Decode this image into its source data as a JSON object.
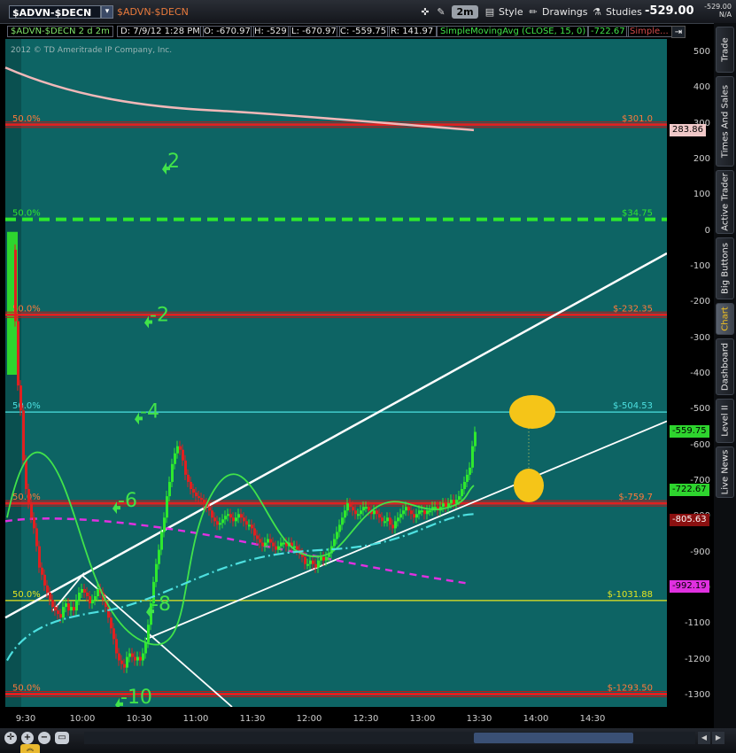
{
  "toolbar": {
    "symbol": "$ADVN-$DECN",
    "symbol_label": "$ADVN-$DECN",
    "aggregation": "2m",
    "style_label": "Style",
    "drawings_label": "Drawings",
    "studies_label": "Studies",
    "last_price": "-529.00",
    "mini_quote_price": "-529.00",
    "mini_quote_change": "N/A"
  },
  "infobar": {
    "symbol_period": "$ADVN-$DECN 2 d 2m",
    "date": "D: 7/9/12 1:28 PM",
    "open": "O: -670.97",
    "high": "H: -529",
    "low": "L: -670.97",
    "close": "C: -559.75",
    "range": "R: 141.97",
    "study": "SimpleMovingAvg (CLOSE, 15, 0)",
    "study_value": "-722.67",
    "study2": "Simple..."
  },
  "copyright": "2012 © TD Ameritrade IP Company, Inc.",
  "chart_data": {
    "type": "candlestick",
    "y_axis": {
      "min": -1330,
      "max": 540,
      "ticks": [
        500,
        400,
        300,
        200,
        100,
        0,
        -100,
        -200,
        -300,
        -400,
        -500,
        -600,
        -700,
        -800,
        -900,
        -1000,
        -1100,
        -1200,
        -1300
      ]
    },
    "x_axis": {
      "ticks": [
        "9:30",
        "10:00",
        "10:30",
        "11:00",
        "11:30",
        "12:00",
        "12:30",
        "13:00",
        "13:30",
        "14:00",
        "14:30"
      ]
    },
    "background_color": "#0d6464",
    "level_lines": [
      {
        "value": 300,
        "color": "#e02020",
        "left_label": "50.0%",
        "right_label": "$301.0",
        "badge": ""
      },
      {
        "value": 35,
        "color": "#2ee82e",
        "left_label": "50.0%",
        "right_label": "$34.75",
        "dashed": true,
        "badge": ""
      },
      {
        "value": -232,
        "color": "#e02020",
        "left_label": "50.0%",
        "right_label": "$-232.35",
        "badge": ""
      },
      {
        "value": -504.5,
        "color": "#4de0e0",
        "left_label": "50.0%",
        "right_label": "$-504.53",
        "badge": ""
      },
      {
        "value": -760,
        "color": "#e02020",
        "left_label": "50.0%",
        "right_label": "$-759.7",
        "badge": ""
      },
      {
        "value": -1032,
        "color": "#e6e620",
        "left_label": "50.0%",
        "right_label": "$-1031.88",
        "badge": ""
      },
      {
        "value": -1294,
        "color": "#e02020",
        "left_label": "50.0%",
        "right_label": "$-1293.50",
        "badge": ""
      }
    ],
    "tick_annotations": [
      "2",
      "-2",
      "-4",
      "-6",
      "-8",
      "-10"
    ],
    "badges": [
      {
        "value": 283.86,
        "label": "283.86",
        "bg": "#f0c8c8",
        "fg": "#000"
      },
      {
        "value": -559.75,
        "label": "-559.75",
        "bg": "#2ed52e",
        "fg": "#000"
      },
      {
        "value": -722.67,
        "label": "-722.67",
        "bg": "#2ed52e",
        "fg": "#000"
      },
      {
        "value": -805.63,
        "label": "-805.63",
        "bg": "#8a1010",
        "fg": "#fff"
      },
      {
        "value": -992.19,
        "label": "-992.19",
        "bg": "#e030e0",
        "fg": "#000"
      }
    ],
    "series": [
      {
        "name": "SimpleMovingAvg (CLOSE, 15, 0)",
        "color": "#41e34a"
      }
    ]
  },
  "sidebar": {
    "tabs": [
      "Trade",
      "Times And Sales",
      "Active Trader",
      "Big Buttons",
      "Chart",
      "Dashboard",
      "Level II",
      "Live News"
    ],
    "active": "Chart"
  }
}
